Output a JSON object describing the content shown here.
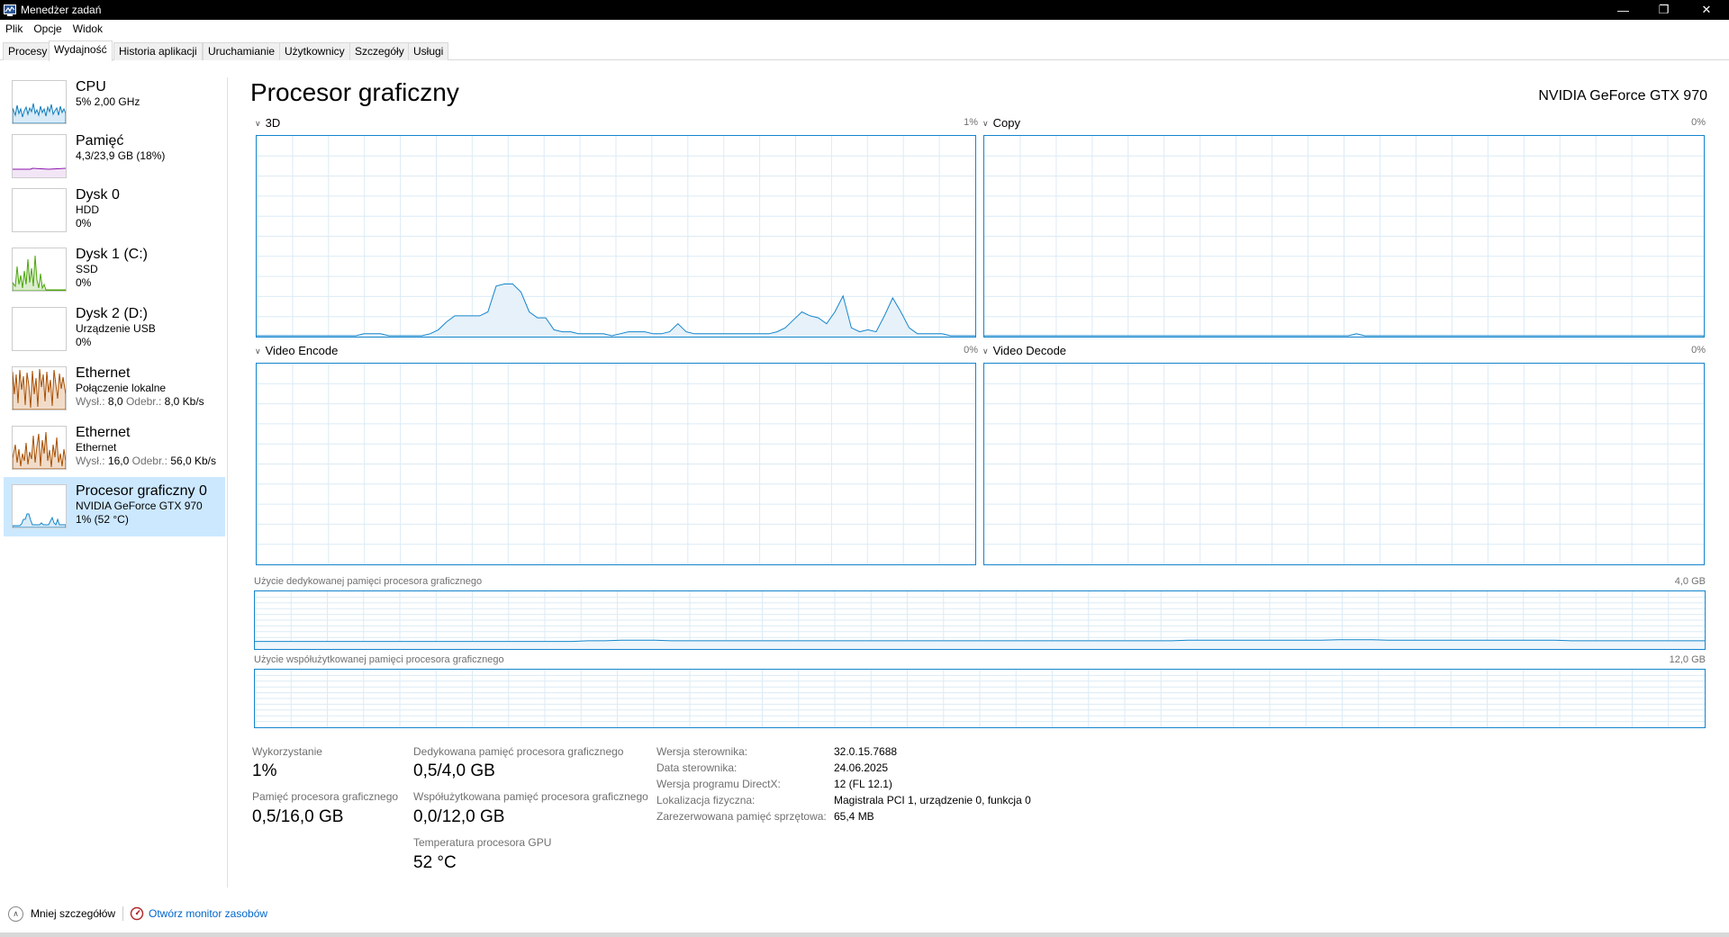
{
  "window": {
    "title": "Menedżer zadań",
    "controls": {
      "minimize": "—",
      "restore": "❐",
      "close": "✕"
    }
  },
  "menu": {
    "items": [
      "Plik",
      "Opcje",
      "Widok"
    ]
  },
  "tabs": [
    "Procesy",
    "Wydajność",
    "Historia aplikacji",
    "Uruchamianie",
    "Użytkownicy",
    "Szczegóły",
    "Usługi"
  ],
  "active_tab": "Wydajność",
  "sidebar": {
    "items": [
      {
        "name": "CPU",
        "line1": "5% 2,00 GHz",
        "line2": "",
        "color": "#117dbb"
      },
      {
        "name": "Pamięć",
        "line1": "4,3/23,9 GB (18%)",
        "line2": "",
        "color": "#8b12ae"
      },
      {
        "name": "Dysk 0",
        "line1": "HDD",
        "line2": "0%",
        "color": "#4da60c"
      },
      {
        "name": "Dysk 1 (C:)",
        "line1": "SSD",
        "line2": "0%",
        "color": "#4da60c"
      },
      {
        "name": "Dysk 2 (D:)",
        "line1": "Urządzenie USB",
        "line2": "0%",
        "color": "#4da60c"
      },
      {
        "name": "Ethernet",
        "line1": "Połączenie lokalne",
        "send_label": "Wysł.:",
        "send": "8,0",
        "recv_label": "Odebr.:",
        "recv": "8,0 Kb/s",
        "color": "#a74f01"
      },
      {
        "name": "Ethernet",
        "line1": "Ethernet",
        "send_label": "Wysł.:",
        "send": "16,0",
        "recv_label": "Odebr.:",
        "recv": "56,0 Kb/s",
        "color": "#a74f01"
      },
      {
        "name": "Procesor graficzny 0",
        "line1": "NVIDIA GeForce GTX 970",
        "line2": "1% (52 °C)",
        "color": "#1485cc"
      }
    ]
  },
  "main": {
    "title": "Procesor graficzny",
    "model": "NVIDIA GeForce GTX 970",
    "engines": [
      {
        "name": "3D",
        "pct": "1%"
      },
      {
        "name": "Copy",
        "pct": "0%"
      },
      {
        "name": "Video Encode",
        "pct": "0%"
      },
      {
        "name": "Video Decode",
        "pct": "0%"
      }
    ],
    "dedicated_mem_label": "Użycie dedykowanej pamięci procesora graficznego",
    "dedicated_mem_max": "4,0 GB",
    "shared_mem_label": "Użycie współużytkowanej pamięci procesora graficznego",
    "shared_mem_max": "12,0 GB"
  },
  "stats": {
    "utilization_label": "Wykorzystanie",
    "utilization": "1%",
    "gpu_mem_label": "Pamięć procesora graficznego",
    "gpu_mem": "0,5/16,0 GB",
    "dedicated_label": "Dedykowana pamięć procesora graficznego",
    "dedicated": "0,5/4,0 GB",
    "shared_label": "Współużytkowana pamięć procesora graficznego",
    "shared": "0,0/12,0 GB",
    "temp_label": "Temperatura procesora GPU",
    "temp": "52 °C"
  },
  "info": [
    {
      "label": "Wersja sterownika:",
      "value": "32.0.15.7688"
    },
    {
      "label": "Data sterownika:",
      "value": "24.06.2025"
    },
    {
      "label": "Wersja programu DirectX:",
      "value": "12 (FL 12.1)"
    },
    {
      "label": "Lokalizacja fizyczna:",
      "value": "Magistrala PCI 1, urządzenie 0, funkcja 0"
    },
    {
      "label": "Zarezerwowana pamięć sprzętowa:",
      "value": "65,4 MB"
    }
  ],
  "footer": {
    "less_details": "Mniej szczegółów",
    "open_monitor": "Otwórz monitor zasobów"
  },
  "graph_series": {
    "engine_3d": [
      0,
      0,
      0,
      0,
      0,
      0,
      0,
      0,
      0,
      0,
      0,
      0,
      0,
      1,
      1,
      1,
      0,
      0,
      0,
      0,
      0,
      1,
      3,
      7,
      10,
      10,
      10,
      10,
      12,
      25,
      26,
      26,
      22,
      12,
      9,
      9,
      3,
      2,
      2,
      1,
      1,
      1,
      1,
      0,
      1,
      2,
      2,
      2,
      1,
      1,
      2,
      6,
      2,
      1,
      1,
      1,
      1,
      1,
      1,
      1,
      1,
      1,
      1,
      2,
      4,
      8,
      12,
      10,
      9,
      6,
      12,
      20,
      4,
      2,
      3,
      2,
      10,
      19,
      12,
      4,
      1,
      1,
      1,
      1,
      0,
      0,
      0,
      0
    ],
    "engine_copy": [
      0,
      0,
      0,
      0,
      0,
      0,
      0,
      0,
      0,
      0,
      0,
      0,
      0,
      0,
      0,
      0,
      0,
      0,
      0,
      0,
      0,
      0,
      0,
      0,
      0,
      0,
      0,
      0,
      0,
      0,
      0,
      0,
      0,
      0,
      0,
      0,
      0,
      0,
      0,
      0,
      0,
      0,
      0,
      0,
      0,
      1,
      0,
      0,
      0,
      0,
      0,
      0,
      0,
      0,
      0,
      0,
      0,
      0,
      0,
      0,
      0,
      0,
      0,
      0,
      0,
      0,
      0,
      0,
      0,
      0,
      0,
      0,
      0,
      0,
      0,
      0,
      0,
      0,
      0,
      0,
      0,
      0,
      0,
      0,
      0,
      0,
      0,
      0
    ],
    "dedicated_mem": [
      12,
      12,
      12,
      12,
      12,
      12,
      12,
      12,
      12,
      12,
      12,
      12,
      12,
      12,
      12,
      12,
      12,
      12,
      12,
      12,
      13,
      13,
      14,
      14,
      14,
      13,
      13,
      13,
      13,
      13,
      13,
      13,
      13,
      13,
      13,
      13,
      13,
      13,
      13,
      13,
      13,
      13,
      13,
      13,
      13,
      13,
      13,
      13,
      13,
      13,
      13,
      13,
      13,
      13,
      13,
      13,
      14,
      14,
      14,
      14,
      14,
      14,
      14,
      14,
      14,
      15,
      15,
      15,
      14,
      14,
      14,
      14,
      14,
      14,
      14,
      14,
      14,
      14,
      14,
      13,
      13,
      13,
      13,
      13,
      13,
      13,
      13,
      13
    ]
  }
}
